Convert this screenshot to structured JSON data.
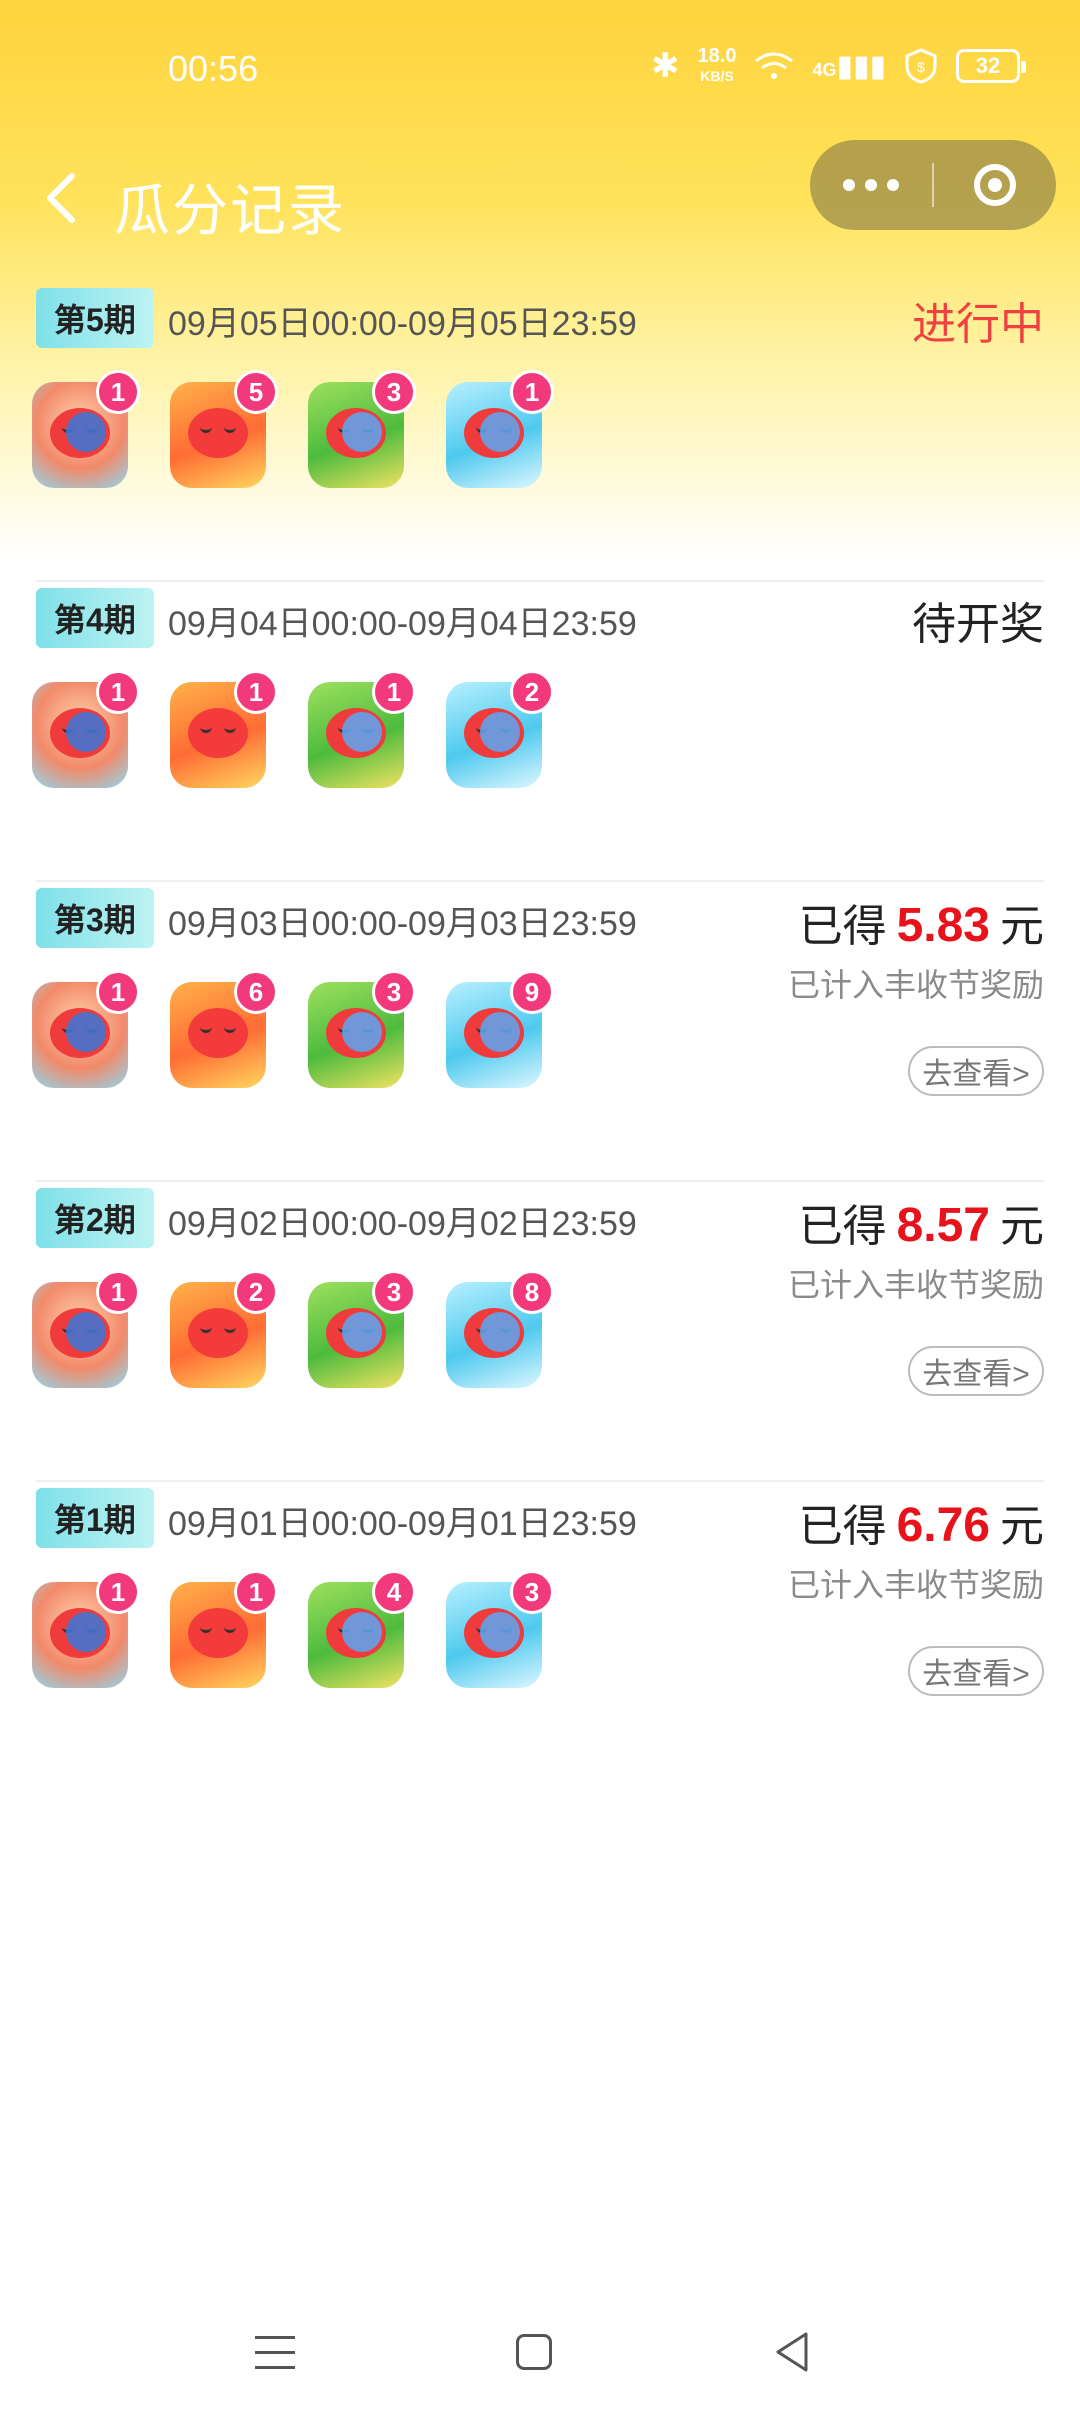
{
  "status_bar": {
    "time": "00:56",
    "bluetooth_icon": "bluetooth-icon",
    "speed_value": "18.0",
    "speed_unit": "KB/S",
    "network": "4G",
    "battery": "32"
  },
  "header": {
    "title": "瓜分记录",
    "back_icon": "chevron-left-icon",
    "more_icon": "more-dots-icon",
    "close_icon": "target-icon"
  },
  "records": [
    {
      "period": "第5期",
      "range": "09月05日00:00-09月05日23:59",
      "status": "进行中",
      "beans": [
        {
          "type": "rice",
          "count": "1"
        },
        {
          "type": "orange",
          "count": "5"
        },
        {
          "type": "osmanthus",
          "count": "3"
        },
        {
          "type": "rain",
          "count": "1"
        }
      ]
    },
    {
      "period": "第4期",
      "range": "09月04日00:00-09月04日23:59",
      "status": "待开奖",
      "beans": [
        {
          "type": "rice",
          "count": "1"
        },
        {
          "type": "orange",
          "count": "1"
        },
        {
          "type": "osmanthus",
          "count": "1"
        },
        {
          "type": "rain",
          "count": "2"
        }
      ]
    },
    {
      "period": "第3期",
      "range": "09月03日00:00-09月03日23:59",
      "earned_prefix": "已得",
      "amount": "5.83",
      "unit": "元",
      "note": "已计入丰收节奖励",
      "view_label": "去查看>",
      "beans": [
        {
          "type": "rice",
          "count": "1"
        },
        {
          "type": "orange",
          "count": "6"
        },
        {
          "type": "osmanthus",
          "count": "3"
        },
        {
          "type": "rain",
          "count": "9"
        }
      ]
    },
    {
      "period": "第2期",
      "range": "09月02日00:00-09月02日23:59",
      "earned_prefix": "已得",
      "amount": "8.57",
      "unit": "元",
      "note": "已计入丰收节奖励",
      "view_label": "去查看>",
      "beans": [
        {
          "type": "rice",
          "count": "1"
        },
        {
          "type": "orange",
          "count": "2"
        },
        {
          "type": "osmanthus",
          "count": "3"
        },
        {
          "type": "rain",
          "count": "8"
        }
      ]
    },
    {
      "period": "第1期",
      "range": "09月01日00:00-09月01日23:59",
      "earned_prefix": "已得",
      "amount": "6.76",
      "unit": "元",
      "note": "已计入丰收节奖励",
      "view_label": "去查看>",
      "beans": [
        {
          "type": "rice",
          "count": "1"
        },
        {
          "type": "orange",
          "count": "1"
        },
        {
          "type": "osmanthus",
          "count": "4"
        },
        {
          "type": "rain",
          "count": "3"
        }
      ]
    }
  ],
  "colors": {
    "header_gradient_top": "#ffd33d",
    "ongoing": "#f04040",
    "amount": "#e8121a",
    "badge": "#7fe0e8",
    "count_badge": "#f2397b"
  },
  "nav_bar": {
    "menu_icon": "menu-icon",
    "home_icon": "home-square-icon",
    "back_icon": "back-triangle-icon"
  }
}
